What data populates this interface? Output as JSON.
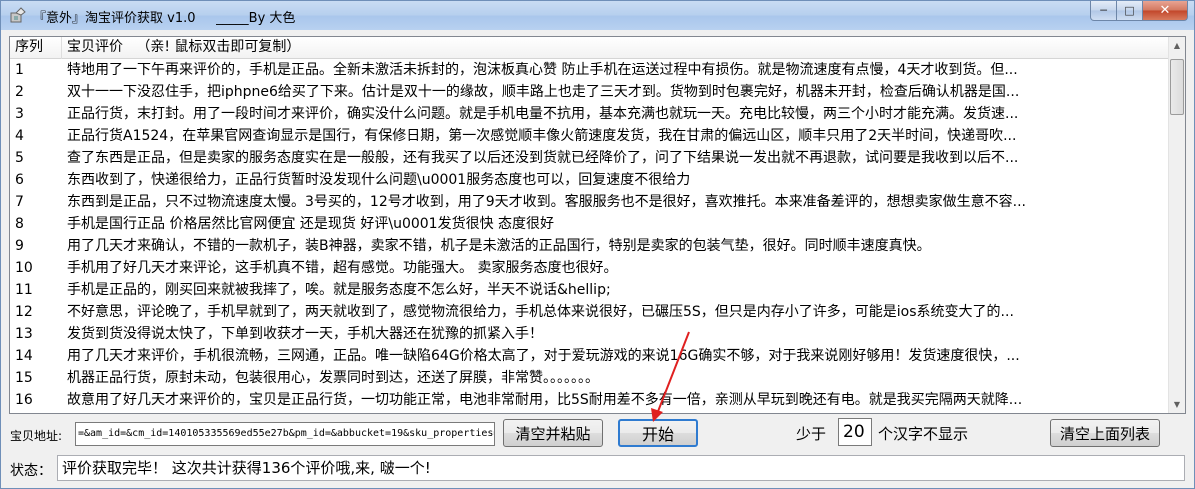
{
  "window": {
    "title": "『意外』淘宝评价获取 v1.0     _____By 大色",
    "buttons": {
      "minimize": "─",
      "maximize": "□",
      "close": "✕"
    }
  },
  "list": {
    "columns": [
      "序列",
      "宝贝评价   （亲! 鼠标双击即可复制）"
    ],
    "rows": [
      {
        "idx": "1",
        "text": "特地用了一下午再来评价的，手机是正品。全新未激活未拆封的，泡沫板真心赞 防止手机在运送过程中有损伤。就是物流速度有点慢，4天才收到货。但..."
      },
      {
        "idx": "2",
        "text": "双十一一下没忍住手，把iphpne6给买了下来。估计是双十一的缘故，顺丰路上也走了三天才到。货物到时包裹完好，机器未开封，检查后确认机器是国..."
      },
      {
        "idx": "3",
        "text": "正品行货，末打封。用了一段时间才来评价，确实没什么问题。就是手机电量不抗用，基本充满也就玩一天。充电比较慢，两三个小时才能充满。发货速..."
      },
      {
        "idx": "4",
        "text": "正品行货A1524，在苹果官网查询显示是国行，有保修日期，第一次感觉顺丰像火箭速度发货，我在甘肃的偏远山区，顺丰只用了2天半时间，快递哥吹..."
      },
      {
        "idx": "5",
        "text": "查了东西是正品，但是卖家的服务态度实在是一般般，还有我买了以后还没到货就已经降价了，问了下结果说一发出就不再退款，试问要是我收到以后不..."
      },
      {
        "idx": "6",
        "text": "东西收到了，快递很给力，正品行货暂时没发现什么问题\\u0001服务态度也可以，回复速度不很给力"
      },
      {
        "idx": "7",
        "text": "东西到是正品，只不过物流速度太慢。3号买的，12号才收到，用了9天才收到。客服服务也不是很好，喜欢推托。本来准备差评的，想想卖家做生意不容..."
      },
      {
        "idx": "8",
        "text": "手机是国行正品 价格居然比官网便宜 还是现货 好评\\u0001发货很快 态度很好"
      },
      {
        "idx": "9",
        "text": "用了几天才来确认，不错的一款机子，装B神器，卖家不错，机子是未激活的正品国行，特别是卖家的包装气垫，很好。同时顺丰速度真快。"
      },
      {
        "idx": "10",
        "text": "手机用了好几天才来评论，这手机真不错，超有感觉。功能强大。 卖家服务态度也很好。"
      },
      {
        "idx": "11",
        "text": "手机是正品的，刚买回来就被我摔了，唉。就是服务态度不怎么好，半天不说话&hellip;"
      },
      {
        "idx": "12",
        "text": "不好意思，评论晚了，手机早就到了，两天就收到了，感觉物流很给力，手机总体来说很好，已碾压5S，但只是内存小了许多，可能是ios系统变大了的..."
      },
      {
        "idx": "13",
        "text": "发货到货没得说太快了，下单到收获才一天，手机大器还在犹豫的抓紧入手！"
      },
      {
        "idx": "14",
        "text": "用了几天才来评价，手机很流畅，三网通，正品。唯一缺陷64G价格太高了，对于爱玩游戏的来说16G确实不够，对于我来说刚好够用！发货速度很快，..."
      },
      {
        "idx": "15",
        "text": "机器正品行货，原封未动，包装很用心，发票同时到达，还送了屏膜，非常赞。。。。。。。"
      },
      {
        "idx": "16",
        "text": "故意用了好几天才来评价的，宝贝是正品行货，一切功能正常，电池非常耐用，比5S耐用差不多有一倍，亲测从早玩到晚还有电。就是我买完隔两天就降..."
      }
    ]
  },
  "controls": {
    "address_label": "宝贝地址:",
    "address_value": "=&am_id=&cm_id=140105335569ed55e27b&pm_id=&abbucket=19&sku_properties=",
    "clear_paste_label": "清空并粘贴",
    "start_label": "开始",
    "min_label": "少于",
    "min_value": "20",
    "chars_label": "个汉字不显示",
    "clear_list_label": "清空上面列表"
  },
  "status": {
    "label": "状态：",
    "text": "评价获取完毕！ 这次共计获得136个评价哦,来, 啵一个!"
  },
  "colors": {
    "annotation_arrow": "#e02020",
    "start_focus": "#2f7bd0"
  }
}
